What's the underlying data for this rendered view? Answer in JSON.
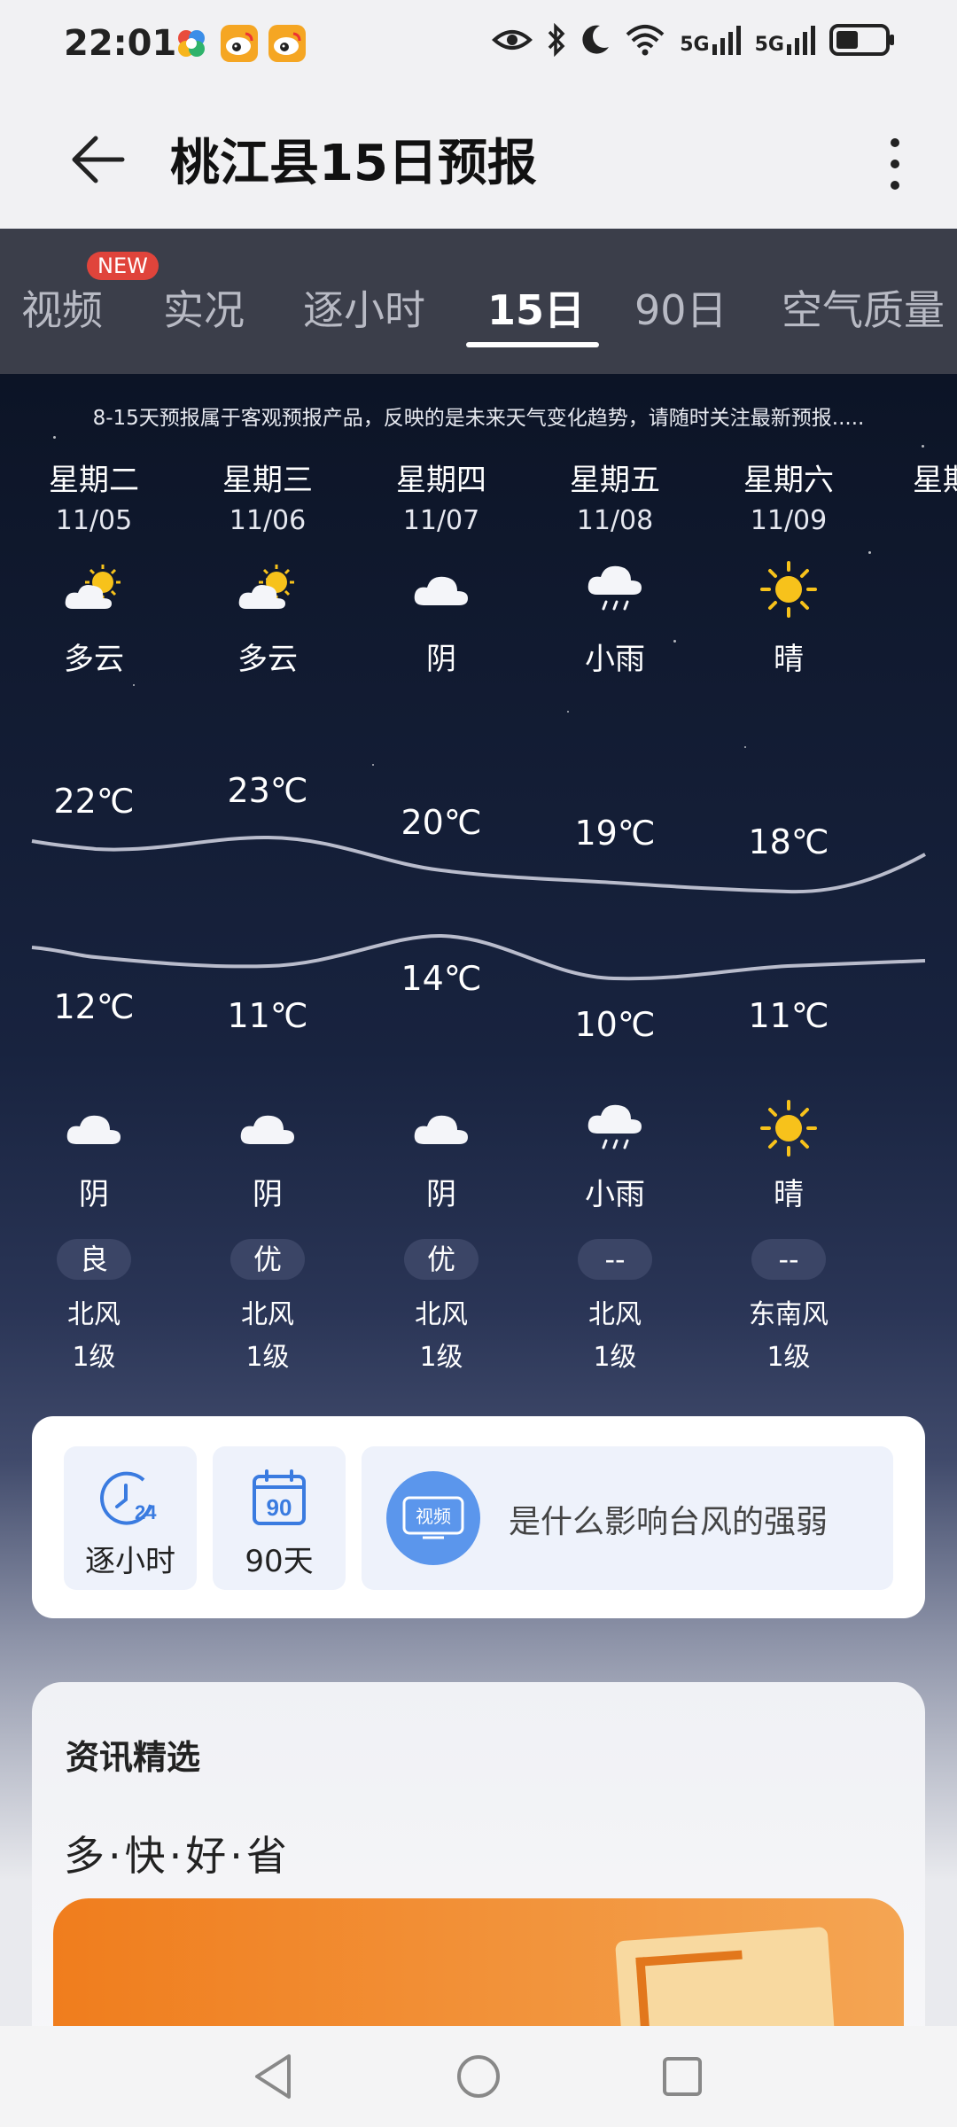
{
  "status": {
    "time": "22:01",
    "network": [
      "5G",
      "5G"
    ]
  },
  "header": {
    "title": "桃江县15日预报"
  },
  "tabs": [
    {
      "label": "视频",
      "badge": "NEW"
    },
    {
      "label": "实况"
    },
    {
      "label": "逐小时"
    },
    {
      "label": "15日",
      "active": true
    },
    {
      "label": "90日"
    },
    {
      "label": "空气质量"
    }
  ],
  "disclaimer": "8-15天预报属于客观预报产品，反映的是未来天气变化趋势，请随时关注最新预报.....",
  "days": [
    {
      "weekday": "星期二",
      "date": "11/05",
      "day_icon": "partly-cloudy-icon",
      "day_cond": "多云",
      "high": "22℃",
      "low": "12℃",
      "night_icon": "cloud-icon",
      "night_cond": "阴",
      "aqi": "良",
      "wind_dir": "北风",
      "wind_level": "1级"
    },
    {
      "weekday": "星期三",
      "date": "11/06",
      "day_icon": "partly-cloudy-icon",
      "day_cond": "多云",
      "high": "23℃",
      "low": "11℃",
      "night_icon": "cloud-icon",
      "night_cond": "阴",
      "aqi": "优",
      "wind_dir": "北风",
      "wind_level": "1级"
    },
    {
      "weekday": "星期四",
      "date": "11/07",
      "day_icon": "cloud-icon",
      "day_cond": "阴",
      "high": "20℃",
      "low": "14℃",
      "night_icon": "cloud-icon",
      "night_cond": "阴",
      "aqi": "优",
      "wind_dir": "北风",
      "wind_level": "1级"
    },
    {
      "weekday": "星期五",
      "date": "11/08",
      "day_icon": "light-rain-icon",
      "day_cond": "小雨",
      "high": "19℃",
      "low": "10℃",
      "night_icon": "light-rain-icon",
      "night_cond": "小雨",
      "aqi": "--",
      "wind_dir": "北风",
      "wind_level": "1级"
    },
    {
      "weekday": "星期六",
      "date": "11/09",
      "day_icon": "sun-icon",
      "day_cond": "晴",
      "high": "18℃",
      "low": "11℃",
      "night_icon": "sun-icon",
      "night_cond": "晴",
      "aqi": "--",
      "wind_dir": "东南风",
      "wind_level": "1级"
    }
  ],
  "shortcuts": {
    "hourly_label": "逐小时",
    "hourly_icon_text": "24",
    "ninety_label": "90天",
    "ninety_icon_text": "90",
    "video_badge": "视频",
    "video_title": "是什么影响台风的强弱"
  },
  "news": {
    "heading": "资讯精选",
    "slogan": "多·快·好·省"
  },
  "colors": {
    "tab_bar": "#3b3e4a",
    "sky_top": "#0c1426",
    "accent_blue": "#5b96ec",
    "sun": "#f7c21b"
  }
}
